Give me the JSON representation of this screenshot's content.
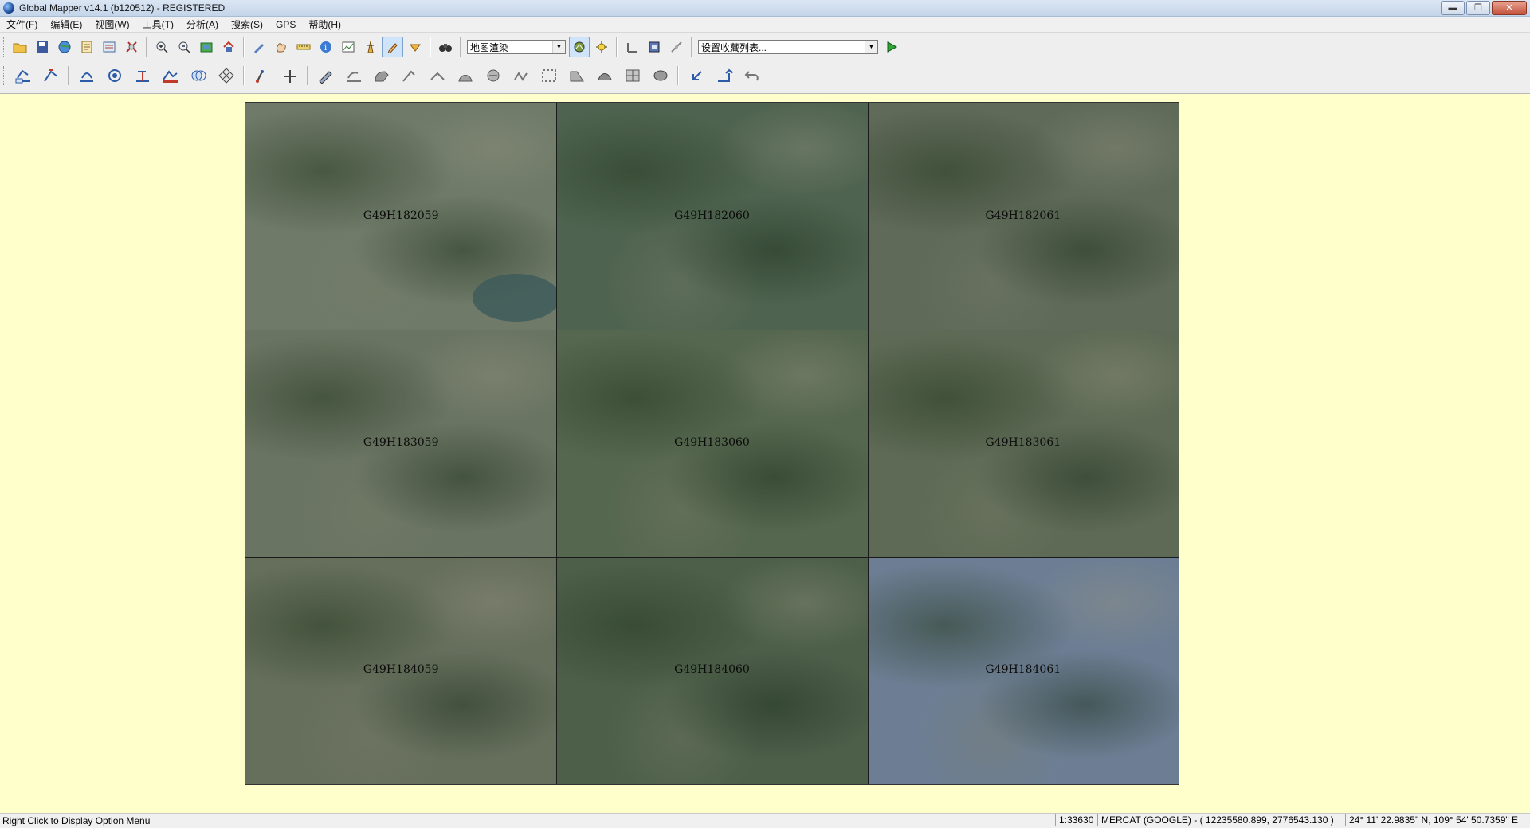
{
  "window": {
    "title": "Global Mapper v14.1 (b120512) - REGISTERED",
    "minimize": "▬",
    "restore": "❐",
    "close": "✕"
  },
  "menu": [
    "文件(F)",
    "编辑(E)",
    "视图(W)",
    "工具(T)",
    "分析(A)",
    "搜索(S)",
    "GPS",
    "帮助(H)"
  ],
  "toolbar": {
    "render_mode": "地图渲染",
    "favorites": "设置收藏列表..."
  },
  "map": {
    "background": "#ffffcc",
    "tiles": [
      {
        "label": "G49H182059",
        "color": "#6f7a68"
      },
      {
        "label": "G49H182060",
        "color": "#4f6450"
      },
      {
        "label": "G49H182061",
        "color": "#5f6a58"
      },
      {
        "label": "G49H183059",
        "color": "#6a7462"
      },
      {
        "label": "G49H183060",
        "color": "#56674f"
      },
      {
        "label": "G49H183061",
        "color": "#5e6a55"
      },
      {
        "label": "G49H184059",
        "color": "#666f5c"
      },
      {
        "label": "G49H184060",
        "color": "#4d5f49"
      },
      {
        "label": "G49H184061",
        "color": "#6d7e94"
      }
    ]
  },
  "status": {
    "hint": "Right Click to Display Option Menu",
    "scale": "1:33630",
    "projection": "MERCAT (GOOGLE) - ( 12235580.899, 2776543.130 )",
    "latlon": "24° 11' 22.9835\" N, 109° 54' 50.7359\" E"
  }
}
